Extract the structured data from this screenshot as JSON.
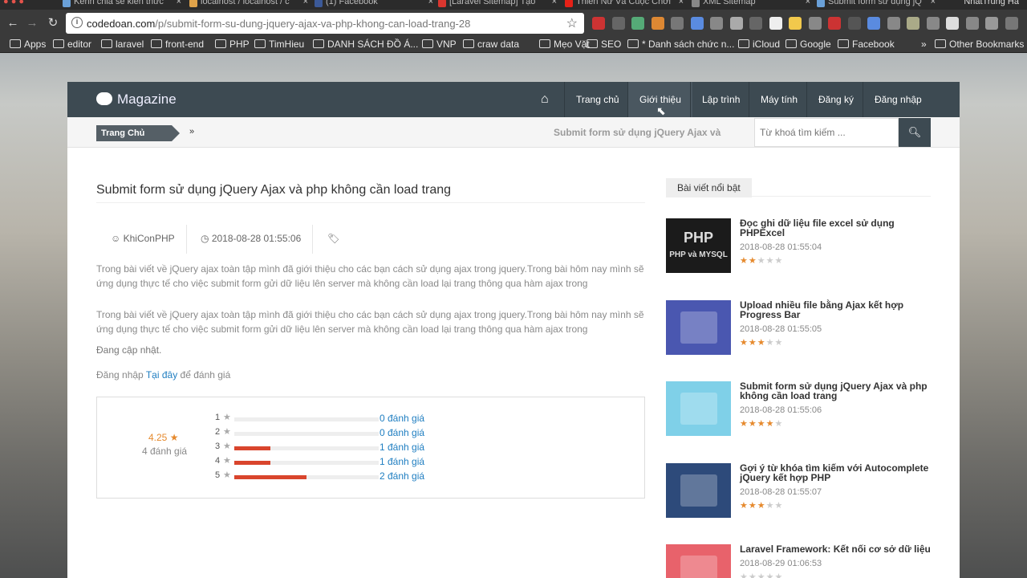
{
  "browser": {
    "tabs": [
      {
        "label": "Kênh chia sẻ kiến thức",
        "color": "#6aa0d8"
      },
      {
        "label": "localhost / localhost / c",
        "color": "#e0a34a"
      },
      {
        "label": "(1) Facebook",
        "color": "#3b5998"
      },
      {
        "label": "[Laravel Sitemap] Tạo",
        "color": "#d9362f"
      },
      {
        "label": "Thiền Nữ Và Cuộc Chơi",
        "color": "#e62117"
      },
      {
        "label": "XML Sitemap",
        "color": "#888888"
      },
      {
        "label": "Submit form sử dụng jQ",
        "color": "#6aa0d8"
      }
    ],
    "tab_close": "×",
    "user": "NhatTrung Ha",
    "url_domain": "codedoan.com",
    "url_path": "/p/submit-form-su-dung-jquery-ajax-va-php-khong-can-load-trang-28",
    "bookmarks": [
      "Apps",
      "editor",
      "laravel",
      "front-end",
      "PHP",
      "TimHieu",
      "DANH SÁCH ĐỒ Á...",
      "VNP",
      "craw data",
      "Mẹo Vặt",
      "SEO",
      "* Danh sách chức n...",
      "iCloud",
      "Google",
      "Facebook"
    ],
    "more_bookmarks": "»",
    "other_bookmarks": "Other Bookmarks"
  },
  "site": {
    "logo": "Magazine",
    "menu": [
      "Trang chủ",
      "Giới thiệu",
      "Lập trình",
      "Máy tính",
      "Đăng ký",
      "Đăng nhập"
    ],
    "breadcrumb": "Trang Chủ",
    "breadcrumb_sep": "»",
    "crumb_title": "Submit form sử dụng jQuery Ajax và",
    "search_placeholder": "Từ khoá tìm kiếm ..."
  },
  "post": {
    "title": "Submit form sử dụng jQuery Ajax và php không cần load trang",
    "author": "KhiConPHP",
    "date": "2018-08-28 01:55:06",
    "para1": "Trong bài viết về jQuery ajax toàn tập mình đã giới thiệu cho các bạn cách sử dụng ajax trong jquery.Trong bài hôm nay mình sẽ ứng dụng thực tế cho việc submit form gửi dữ liệu lên server mà không cần load lại trang thông qua hàm ajax trong",
    "para2": "Trong bài viết về jQuery ajax toàn tập mình đã giới thiệu cho các bạn cách sử dụng ajax trong jquery.Trong bài hôm nay mình sẽ ứng dụng thực tế cho việc submit form gửi dữ liệu lên server mà không cần load lại trang thông qua hàm ajax trong",
    "updating": "Đang cập nhật.",
    "login_prefix": "Đăng nhập",
    "login_link": "Tại đây",
    "login_suffix": "để đánh giá"
  },
  "rating": {
    "average": "4.25",
    "count_label": "4 đánh giá",
    "rows": [
      {
        "star": "1",
        "fraction": 0.0,
        "label": "0 đánh giá"
      },
      {
        "star": "2",
        "fraction": 0.0,
        "label": "0 đánh giá"
      },
      {
        "star": "3",
        "fraction": 0.25,
        "label": "1 đánh giá"
      },
      {
        "star": "4",
        "fraction": 0.25,
        "label": "1 đánh giá"
      },
      {
        "star": "5",
        "fraction": 0.5,
        "label": "2 đánh giá"
      }
    ]
  },
  "sidebar": {
    "heading": "Bài viết nổi bật",
    "items": [
      {
        "title": "Đọc ghi dữ liệu file excel sử dụng PHPExcel",
        "date": "2018-08-28 01:55:04",
        "stars": 2,
        "thumb_color": "#1b1b1b",
        "thumb_text": "PHP",
        "thumb_sub": "PHP và MYSQL"
      },
      {
        "title": "Upload nhiều file bằng Ajax kết hợp Progress Bar",
        "date": "2018-08-28 01:55:05",
        "stars": 3,
        "thumb_color": "#4a57b0",
        "thumb_text": "",
        "thumb_sub": ""
      },
      {
        "title": "Submit form sử dụng jQuery Ajax và php không cần load trang",
        "date": "2018-08-28 01:55:06",
        "stars": 4,
        "thumb_color": "#7fd0e8",
        "thumb_text": "",
        "thumb_sub": ""
      },
      {
        "title": "Gợi ý từ khóa tìm kiếm với Autocomplete jQuery kết hợp PHP",
        "date": "2018-08-28 01:55:07",
        "stars": 3,
        "thumb_color": "#2d4a7a",
        "thumb_text": "",
        "thumb_sub": ""
      },
      {
        "title": "Laravel Framework: Kết nối cơ sở dữ liệu",
        "date": "2018-08-29 01:06:53",
        "stars": 0,
        "thumb_color": "#e8626b",
        "thumb_text": "",
        "thumb_sub": ""
      }
    ]
  }
}
